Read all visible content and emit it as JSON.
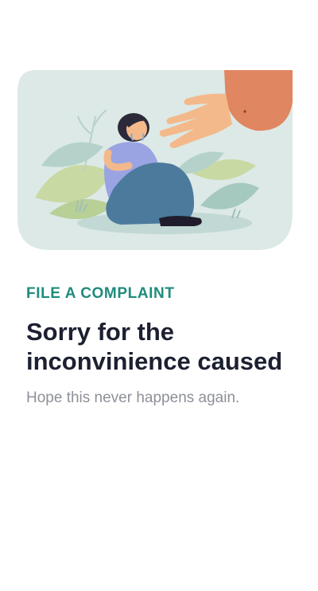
{
  "screen": {
    "eyebrow": "FILE A COMPLAINT",
    "headline": "Sorry for the inconvinience caused",
    "subtext": "Hope this never happens again."
  },
  "illustration": {
    "subject": "sad woman sitting hugging knees with a helping hand reaching toward her",
    "icons": [
      "helping-hand-icon",
      "sad-person-icon",
      "plant-leaves-icon"
    ]
  },
  "colors": {
    "accent": "#1f8c7c",
    "headline": "#1c2030",
    "subtext": "#8e9099",
    "card_background": "#dce9e6",
    "sleeve": "#e08660",
    "skin": "#f4b98b",
    "shirt": "#9aa4e3",
    "pants": "#4b7a9d",
    "leaf_green": "#c8d9a3",
    "leaf_teal": "#a6c9bf"
  }
}
